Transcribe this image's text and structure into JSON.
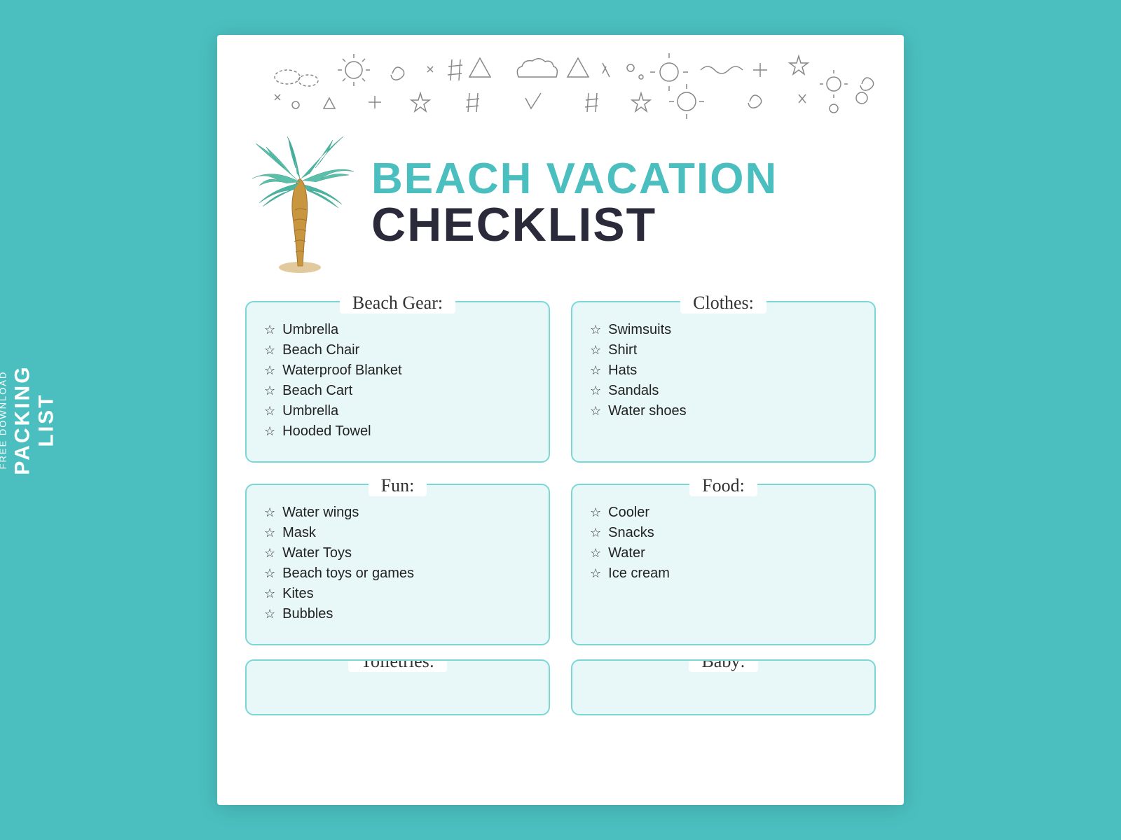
{
  "background_color": "#4bbfbf",
  "side_label": {
    "free_download": "FREE DOWNLOAD",
    "packing_list": "PACKING LIST"
  },
  "hero": {
    "line1": "BEACH VACATION",
    "line2": "CHECKLIST"
  },
  "sections": [
    {
      "title": "Beach Gear:",
      "items": [
        "Umbrella",
        "Beach Chair",
        "Waterproof Blanket",
        "Beach Cart",
        "Umbrella",
        "Hooded Towel"
      ]
    },
    {
      "title": "Clothes:",
      "items": [
        "Swimsuits",
        "Shirt",
        "Hats",
        "Sandals",
        "Water shoes"
      ]
    },
    {
      "title": "Fun:",
      "items": [
        "Water wings",
        "Mask",
        "Water Toys",
        "Beach toys or games",
        "Kites",
        "Bubbles"
      ]
    },
    {
      "title": "Food:",
      "items": [
        "Cooler",
        "Snacks",
        "Water",
        "Ice cream"
      ]
    }
  ],
  "bottom_sections": [
    {
      "title": "Toiletries:"
    },
    {
      "title": "Baby:"
    }
  ],
  "doodles": {
    "label": "decorative doodles"
  }
}
